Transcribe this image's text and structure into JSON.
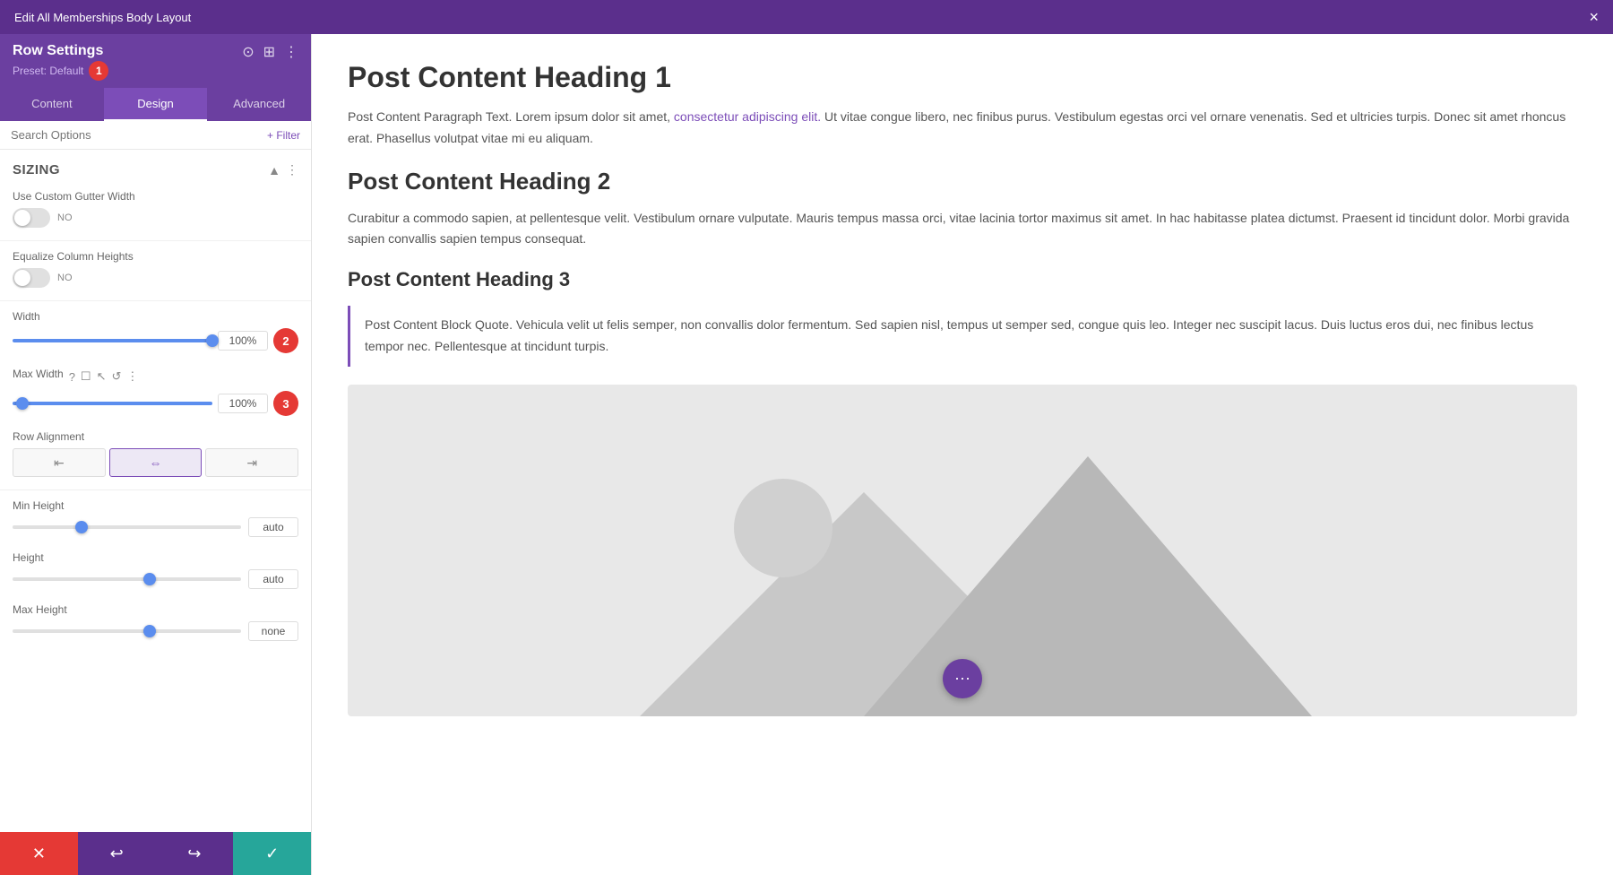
{
  "topBar": {
    "title": "Edit All Memberships Body Layout",
    "closeLabel": "×"
  },
  "rowSettings": {
    "title": "Row Settings",
    "preset": "Preset: Default",
    "badgeNumber": "1"
  },
  "tabs": [
    {
      "id": "content",
      "label": "Content",
      "active": false
    },
    {
      "id": "design",
      "label": "Design",
      "active": true
    },
    {
      "id": "advanced",
      "label": "Advanced",
      "active": false
    }
  ],
  "search": {
    "placeholder": "Search Options",
    "filterLabel": "+ Filter"
  },
  "sizing": {
    "sectionTitle": "Sizing",
    "customGutterWidth": {
      "label": "Use Custom Gutter Width",
      "toggleValue": "NO"
    },
    "equalizeColumnHeights": {
      "label": "Equalize Column Heights",
      "toggleValue": "NO"
    },
    "width": {
      "label": "Width",
      "value": "100%",
      "pct": 100,
      "badge": "2"
    },
    "maxWidth": {
      "label": "Max Width",
      "value": "100%",
      "badge": "3"
    },
    "rowAlignment": {
      "label": "Row Alignment",
      "options": [
        "left",
        "center",
        "right"
      ]
    },
    "minHeight": {
      "label": "Min Height",
      "value": "auto"
    },
    "height": {
      "label": "Height",
      "value": "auto"
    },
    "maxHeight": {
      "label": "Max Height",
      "value": "none"
    }
  },
  "bottomBar": {
    "cancelIcon": "✕",
    "undoIcon": "↩",
    "redoIcon": "↪",
    "saveIcon": "✓"
  },
  "content": {
    "heading1": "Post Content Heading 1",
    "para1a": "Post Content Paragraph Text. Lorem ipsum dolor sit amet, ",
    "para1link": "consectetur adipiscing elit.",
    "para1b": " Ut vitae congue libero, nec finibus purus. Vestibulum egestas orci vel ornare venenatis. Sed et ultricies turpis. Donec sit amet rhoncus erat. Phasellus volutpat vitae mi eu aliquam.",
    "heading2": "Post Content Heading 2",
    "para2": "Curabitur a commodo sapien, at pellentesque velit. Vestibulum ornare vulputate. Mauris tempus massa orci, vitae lacinia tortor maximus sit amet. In hac habitasse platea dictumst. Praesent id tincidunt dolor. Morbi gravida sapien convallis sapien tempus consequat.",
    "heading3": "Post Content Heading 3",
    "blockquote": "Post Content Block Quote. Vehicula velit ut felis semper, non convallis dolor fermentum. Sed sapien nisl, tempus ut semper sed, congue quis leo. Integer nec suscipit lacus. Duis luctus eros dui, nec finibus lectus tempor nec. Pellentesque at tincidunt turpis.",
    "floatingMenuIcon": "···"
  }
}
